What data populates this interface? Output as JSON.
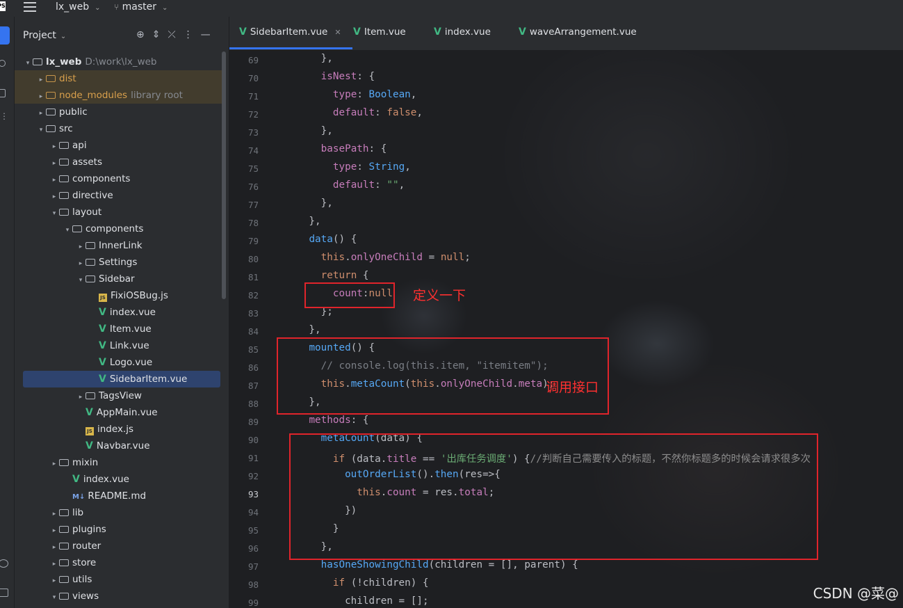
{
  "topbar": {
    "logo": "PS",
    "project": "lx_web",
    "branch": "master"
  },
  "panel": {
    "title": "Project"
  },
  "tree": [
    {
      "depth": 0,
      "arrow": "▾",
      "icon": "folder",
      "label": "lx_web",
      "hint": "D:\\work\\lx_web",
      "bold": true
    },
    {
      "depth": 1,
      "arrow": "▸",
      "icon": "folder-orange",
      "label": "dist",
      "orange": true,
      "hl": true
    },
    {
      "depth": 1,
      "arrow": "▸",
      "icon": "folder-orange",
      "label": "node_modules",
      "hint": "library root",
      "orange": true,
      "hl": true
    },
    {
      "depth": 1,
      "arrow": "▸",
      "icon": "folder",
      "label": "public"
    },
    {
      "depth": 1,
      "arrow": "▾",
      "icon": "folder",
      "label": "src"
    },
    {
      "depth": 2,
      "arrow": "▸",
      "icon": "folder",
      "label": "api"
    },
    {
      "depth": 2,
      "arrow": "▸",
      "icon": "folder",
      "label": "assets"
    },
    {
      "depth": 2,
      "arrow": "▸",
      "icon": "folder",
      "label": "components"
    },
    {
      "depth": 2,
      "arrow": "▸",
      "icon": "folder",
      "label": "directive"
    },
    {
      "depth": 2,
      "arrow": "▾",
      "icon": "folder",
      "label": "layout"
    },
    {
      "depth": 3,
      "arrow": "▾",
      "icon": "folder",
      "label": "components"
    },
    {
      "depth": 4,
      "arrow": "▸",
      "icon": "folder",
      "label": "InnerLink"
    },
    {
      "depth": 4,
      "arrow": "▸",
      "icon": "folder",
      "label": "Settings"
    },
    {
      "depth": 4,
      "arrow": "▾",
      "icon": "folder",
      "label": "Sidebar"
    },
    {
      "depth": 5,
      "arrow": "",
      "icon": "js",
      "label": "FixiOSBug.js"
    },
    {
      "depth": 5,
      "arrow": "",
      "icon": "vue",
      "label": "index.vue"
    },
    {
      "depth": 5,
      "arrow": "",
      "icon": "vue",
      "label": "Item.vue"
    },
    {
      "depth": 5,
      "arrow": "",
      "icon": "vue",
      "label": "Link.vue"
    },
    {
      "depth": 5,
      "arrow": "",
      "icon": "vue",
      "label": "Logo.vue"
    },
    {
      "depth": 5,
      "arrow": "",
      "icon": "vue",
      "label": "SidebarItem.vue",
      "selected": true
    },
    {
      "depth": 4,
      "arrow": "▸",
      "icon": "folder",
      "label": "TagsView"
    },
    {
      "depth": 4,
      "arrow": "",
      "icon": "vue",
      "label": "AppMain.vue"
    },
    {
      "depth": 4,
      "arrow": "",
      "icon": "js",
      "label": "index.js"
    },
    {
      "depth": 4,
      "arrow": "",
      "icon": "vue",
      "label": "Navbar.vue"
    },
    {
      "depth": 2,
      "arrow": "▸",
      "icon": "folder",
      "label": "mixin"
    },
    {
      "depth": 3,
      "arrow": "",
      "icon": "vue",
      "label": "index.vue"
    },
    {
      "depth": 3,
      "arrow": "",
      "icon": "md",
      "label": "README.md"
    },
    {
      "depth": 2,
      "arrow": "▸",
      "icon": "folder",
      "label": "lib"
    },
    {
      "depth": 2,
      "arrow": "▸",
      "icon": "folder",
      "label": "plugins"
    },
    {
      "depth": 2,
      "arrow": "▸",
      "icon": "folder",
      "label": "router"
    },
    {
      "depth": 2,
      "arrow": "▸",
      "icon": "folder",
      "label": "store"
    },
    {
      "depth": 2,
      "arrow": "▸",
      "icon": "folder",
      "label": "utils"
    },
    {
      "depth": 2,
      "arrow": "▾",
      "icon": "folder",
      "label": "views"
    }
  ],
  "tabs": [
    {
      "label": "SidebarItem.vue",
      "active": true
    },
    {
      "label": "Item.vue"
    },
    {
      "label": "index.vue"
    },
    {
      "label": "waveArrangement.vue"
    }
  ],
  "code": [
    {
      "n": "69",
      "tokens": [
        [
          "t",
          "      },"
        ]
      ]
    },
    {
      "n": "70",
      "tokens": [
        [
          "t",
          "      "
        ],
        [
          "p",
          "isNest"
        ],
        [
          "t",
          ": {"
        ]
      ]
    },
    {
      "n": "71",
      "tokens": [
        [
          "t",
          "        "
        ],
        [
          "p",
          "type"
        ],
        [
          "t",
          ": "
        ],
        [
          "f",
          "Boolean"
        ],
        [
          "t",
          ","
        ]
      ]
    },
    {
      "n": "72",
      "tokens": [
        [
          "t",
          "        "
        ],
        [
          "p",
          "default"
        ],
        [
          "t",
          ": "
        ],
        [
          "k",
          "false"
        ],
        [
          "t",
          ","
        ]
      ]
    },
    {
      "n": "73",
      "tokens": [
        [
          "t",
          "      },"
        ]
      ]
    },
    {
      "n": "74",
      "tokens": [
        [
          "t",
          "      "
        ],
        [
          "p",
          "basePath"
        ],
        [
          "t",
          ": {"
        ]
      ]
    },
    {
      "n": "75",
      "tokens": [
        [
          "t",
          "        "
        ],
        [
          "p",
          "type"
        ],
        [
          "t",
          ": "
        ],
        [
          "f",
          "String"
        ],
        [
          "t",
          ","
        ]
      ]
    },
    {
      "n": "76",
      "tokens": [
        [
          "t",
          "        "
        ],
        [
          "p",
          "default"
        ],
        [
          "t",
          ": "
        ],
        [
          "s",
          "\"\""
        ],
        [
          "t",
          ","
        ]
      ]
    },
    {
      "n": "77",
      "tokens": [
        [
          "t",
          "      },"
        ]
      ]
    },
    {
      "n": "78",
      "tokens": [
        [
          "t",
          "    },"
        ]
      ]
    },
    {
      "n": "79",
      "tokens": [
        [
          "t",
          "    "
        ],
        [
          "f",
          "data"
        ],
        [
          "t",
          "() {"
        ]
      ]
    },
    {
      "n": "80",
      "tokens": [
        [
          "t",
          "      "
        ],
        [
          "k",
          "this"
        ],
        [
          "t",
          "."
        ],
        [
          "p",
          "onlyOneChild"
        ],
        [
          "t",
          " = "
        ],
        [
          "k",
          "null"
        ],
        [
          "t",
          ";"
        ]
      ]
    },
    {
      "n": "81",
      "tokens": [
        [
          "t",
          "      "
        ],
        [
          "k",
          "return"
        ],
        [
          "t",
          " {"
        ]
      ]
    },
    {
      "n": "82",
      "tokens": [
        [
          "t",
          "        "
        ],
        [
          "p",
          "count"
        ],
        [
          "t",
          ":"
        ],
        [
          "k",
          "null"
        ]
      ]
    },
    {
      "n": "83",
      "tokens": [
        [
          "t",
          "      };"
        ]
      ]
    },
    {
      "n": "84",
      "tokens": [
        [
          "t",
          "    },"
        ]
      ]
    },
    {
      "n": "85",
      "tokens": [
        [
          "t",
          "    "
        ],
        [
          "f",
          "mounted"
        ],
        [
          "t",
          "() {"
        ]
      ]
    },
    {
      "n": "86",
      "tokens": [
        [
          "t",
          "      "
        ],
        [
          "c",
          "// console.log(this.item, \"itemitem\");"
        ]
      ]
    },
    {
      "n": "87",
      "tokens": [
        [
          "t",
          "      "
        ],
        [
          "k",
          "this"
        ],
        [
          "t",
          "."
        ],
        [
          "f",
          "metaCount"
        ],
        [
          "t",
          "("
        ],
        [
          "k",
          "this"
        ],
        [
          "t",
          "."
        ],
        [
          "p",
          "onlyOneChild"
        ],
        [
          "t",
          "."
        ],
        [
          "p",
          "meta"
        ],
        [
          "t",
          ");"
        ]
      ]
    },
    {
      "n": "88",
      "tokens": [
        [
          "t",
          "    },"
        ]
      ]
    },
    {
      "n": "89",
      "tokens": [
        [
          "t",
          "    "
        ],
        [
          "p",
          "methods"
        ],
        [
          "t",
          ": {"
        ]
      ]
    },
    {
      "n": "90",
      "tokens": [
        [
          "t",
          "      "
        ],
        [
          "f",
          "metaCount"
        ],
        [
          "t",
          "(data) {"
        ]
      ]
    },
    {
      "n": "91",
      "tokens": [
        [
          "t",
          "        "
        ],
        [
          "k",
          "if"
        ],
        [
          "t",
          " (data."
        ],
        [
          "p",
          "title"
        ],
        [
          "t",
          " == "
        ],
        [
          "s",
          "'出库任务调度'"
        ],
        [
          "t",
          ") {"
        ],
        [
          "cn",
          "//判断自己需要传入的标题，不然你标题多的时候会请求很多次"
        ]
      ]
    },
    {
      "n": "92",
      "tokens": [
        [
          "t",
          "          "
        ],
        [
          "f",
          "outOrderList"
        ],
        [
          "t",
          "()."
        ],
        [
          "f",
          "then"
        ],
        [
          "t",
          "(res=>{"
        ]
      ]
    },
    {
      "n": "93",
      "tokens": [
        [
          "t",
          "            "
        ],
        [
          "k",
          "this"
        ],
        [
          "t",
          "."
        ],
        [
          "p",
          "count"
        ],
        [
          "t",
          " = res."
        ],
        [
          "p",
          "total"
        ],
        [
          "t",
          ";"
        ]
      ],
      "current": true
    },
    {
      "n": "94",
      "tokens": [
        [
          "t",
          "          })"
        ]
      ]
    },
    {
      "n": "95",
      "tokens": [
        [
          "t",
          "        }"
        ]
      ]
    },
    {
      "n": "96",
      "tokens": [
        [
          "t",
          "      },"
        ]
      ]
    },
    {
      "n": "97",
      "tokens": [
        [
          "t",
          "      "
        ],
        [
          "f",
          "hasOneShowingChild"
        ],
        [
          "t",
          "(children = [], parent) {"
        ]
      ]
    },
    {
      "n": "98",
      "tokens": [
        [
          "t",
          "        "
        ],
        [
          "k",
          "if"
        ],
        [
          "t",
          " (!children) {"
        ]
      ]
    },
    {
      "n": "99",
      "tokens": [
        [
          "t",
          "          children = [];"
        ]
      ]
    }
  ],
  "annotations": {
    "define": "定义一下",
    "call": "调用接口"
  },
  "watermark": "CSDN @菜@",
  "colors": {
    "accent": "#3574f0",
    "annotation_red": "#e0242b",
    "vue_green": "#41b883"
  }
}
